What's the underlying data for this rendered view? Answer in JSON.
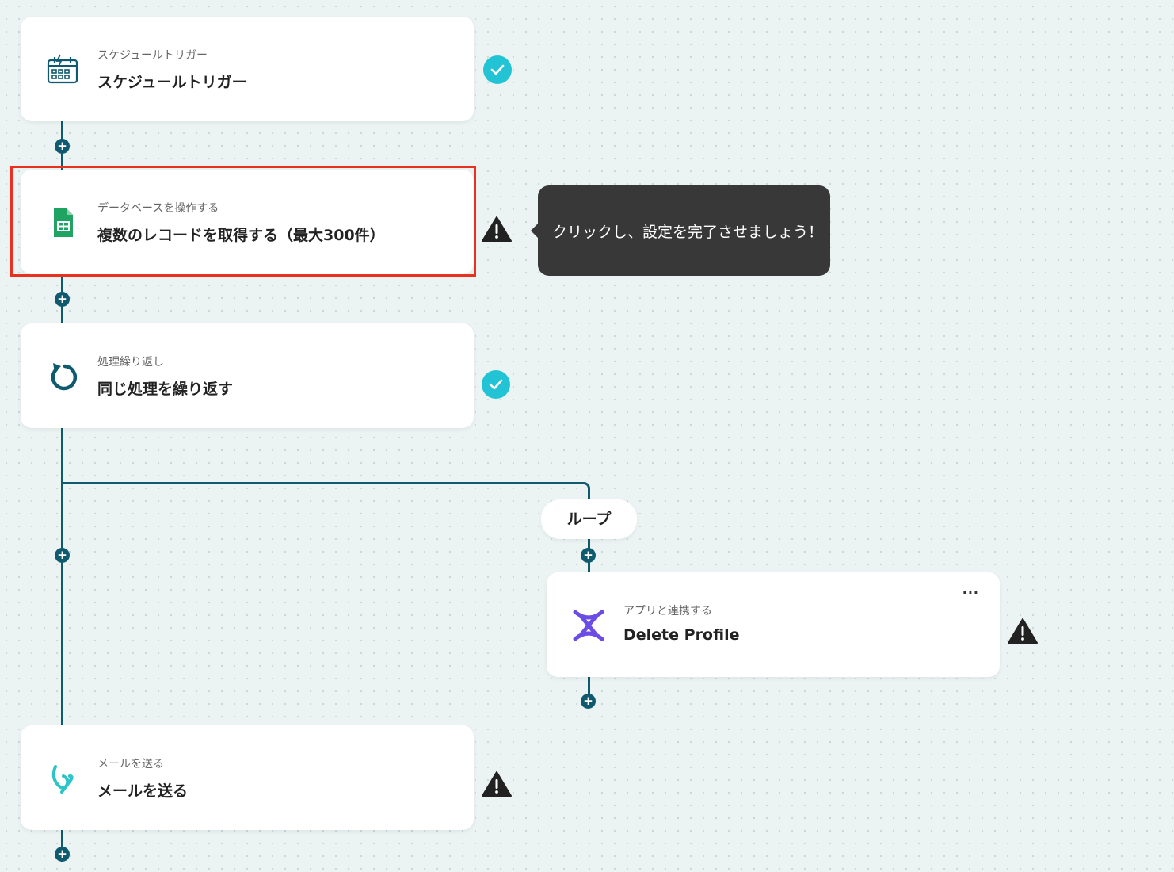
{
  "steps": [
    {
      "subtitle": "スケジュールトリガー",
      "title": "スケジュールトリガー",
      "icon": "calendar-trigger-icon",
      "status": "complete"
    },
    {
      "subtitle": "データベースを操作する",
      "title": "複数のレコードを取得する（最大300件）",
      "icon": "google-sheets-icon",
      "status": "warning"
    },
    {
      "subtitle": "処理繰り返し",
      "title": "同じ処理を繰り返す",
      "icon": "loop-arrow-icon",
      "status": "complete"
    },
    {
      "subtitle": "アプリと連携する",
      "title": "Delete Profile",
      "icon": "app-x-icon",
      "status": "warning"
    },
    {
      "subtitle": "メールを送る",
      "title": "メールを送る",
      "icon": "mail-logo-icon",
      "status": "warning"
    }
  ],
  "tooltip": "クリックし、設定を完了させましょう！",
  "loop_label": "ループ",
  "add_label": "+",
  "more_label": "···",
  "colors": {
    "line": "#0f5a6e",
    "check": "#22c3d4",
    "highlight": "#e8311f",
    "sheets": "#1ea362",
    "app": "#6b4de6",
    "mail": "#2bc4c9"
  }
}
